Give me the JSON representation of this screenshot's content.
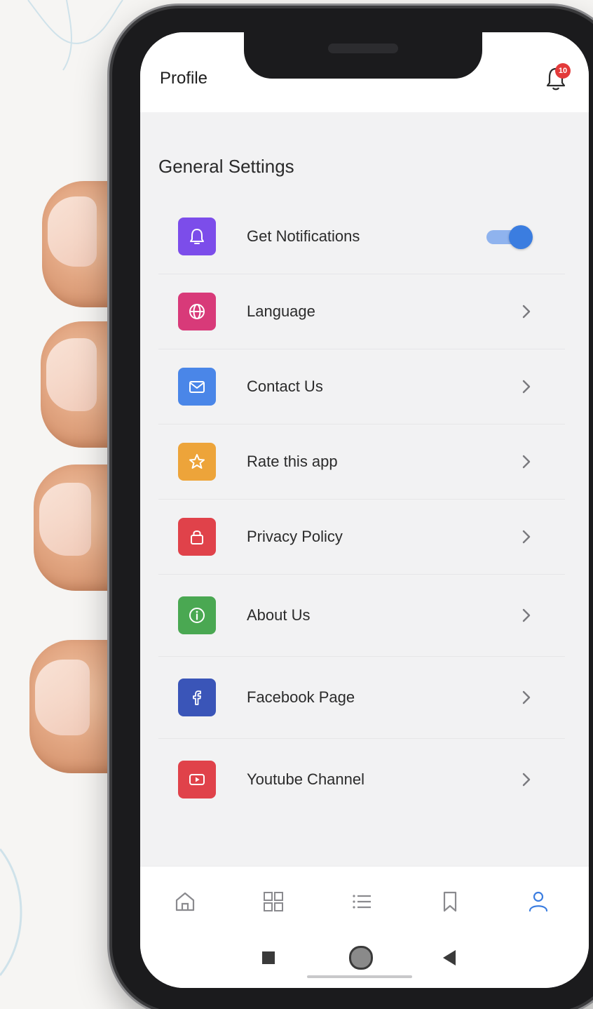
{
  "header": {
    "title": "Profile",
    "notification_count": "10"
  },
  "section": {
    "title": "General Settings"
  },
  "settings": [
    {
      "label": "Get Notifications",
      "icon": "bell-icon",
      "color": "#7c4dea",
      "control": "toggle",
      "enabled": true
    },
    {
      "label": "Language",
      "icon": "globe-icon",
      "color": "#d83a79",
      "control": "chevron"
    },
    {
      "label": "Contact Us",
      "icon": "mail-icon",
      "color": "#4a86e8",
      "control": "chevron"
    },
    {
      "label": "Rate this app",
      "icon": "star-icon",
      "color": "#eda43a",
      "control": "chevron"
    },
    {
      "label": "Privacy Policy",
      "icon": "lock-icon",
      "color": "#e0424a",
      "control": "chevron"
    },
    {
      "label": "About Us",
      "icon": "info-icon",
      "color": "#4aa852",
      "control": "chevron"
    },
    {
      "label": "Facebook Page",
      "icon": "facebook-icon",
      "color": "#3a55b8",
      "control": "chevron"
    },
    {
      "label": "Youtube Channel",
      "icon": "youtube-icon",
      "color": "#e0424a",
      "control": "chevron"
    }
  ],
  "tabbar": {
    "tabs": [
      {
        "icon": "home-icon",
        "active": false
      },
      {
        "icon": "grid-icon",
        "active": false
      },
      {
        "icon": "list-icon",
        "active": false
      },
      {
        "icon": "bookmark-icon",
        "active": false
      },
      {
        "icon": "user-icon",
        "active": true
      }
    ],
    "active_color": "#3b7de0",
    "inactive_color": "#8a8a8e"
  },
  "system_nav": [
    "recent-apps-icon",
    "home-circle-icon",
    "back-icon"
  ]
}
